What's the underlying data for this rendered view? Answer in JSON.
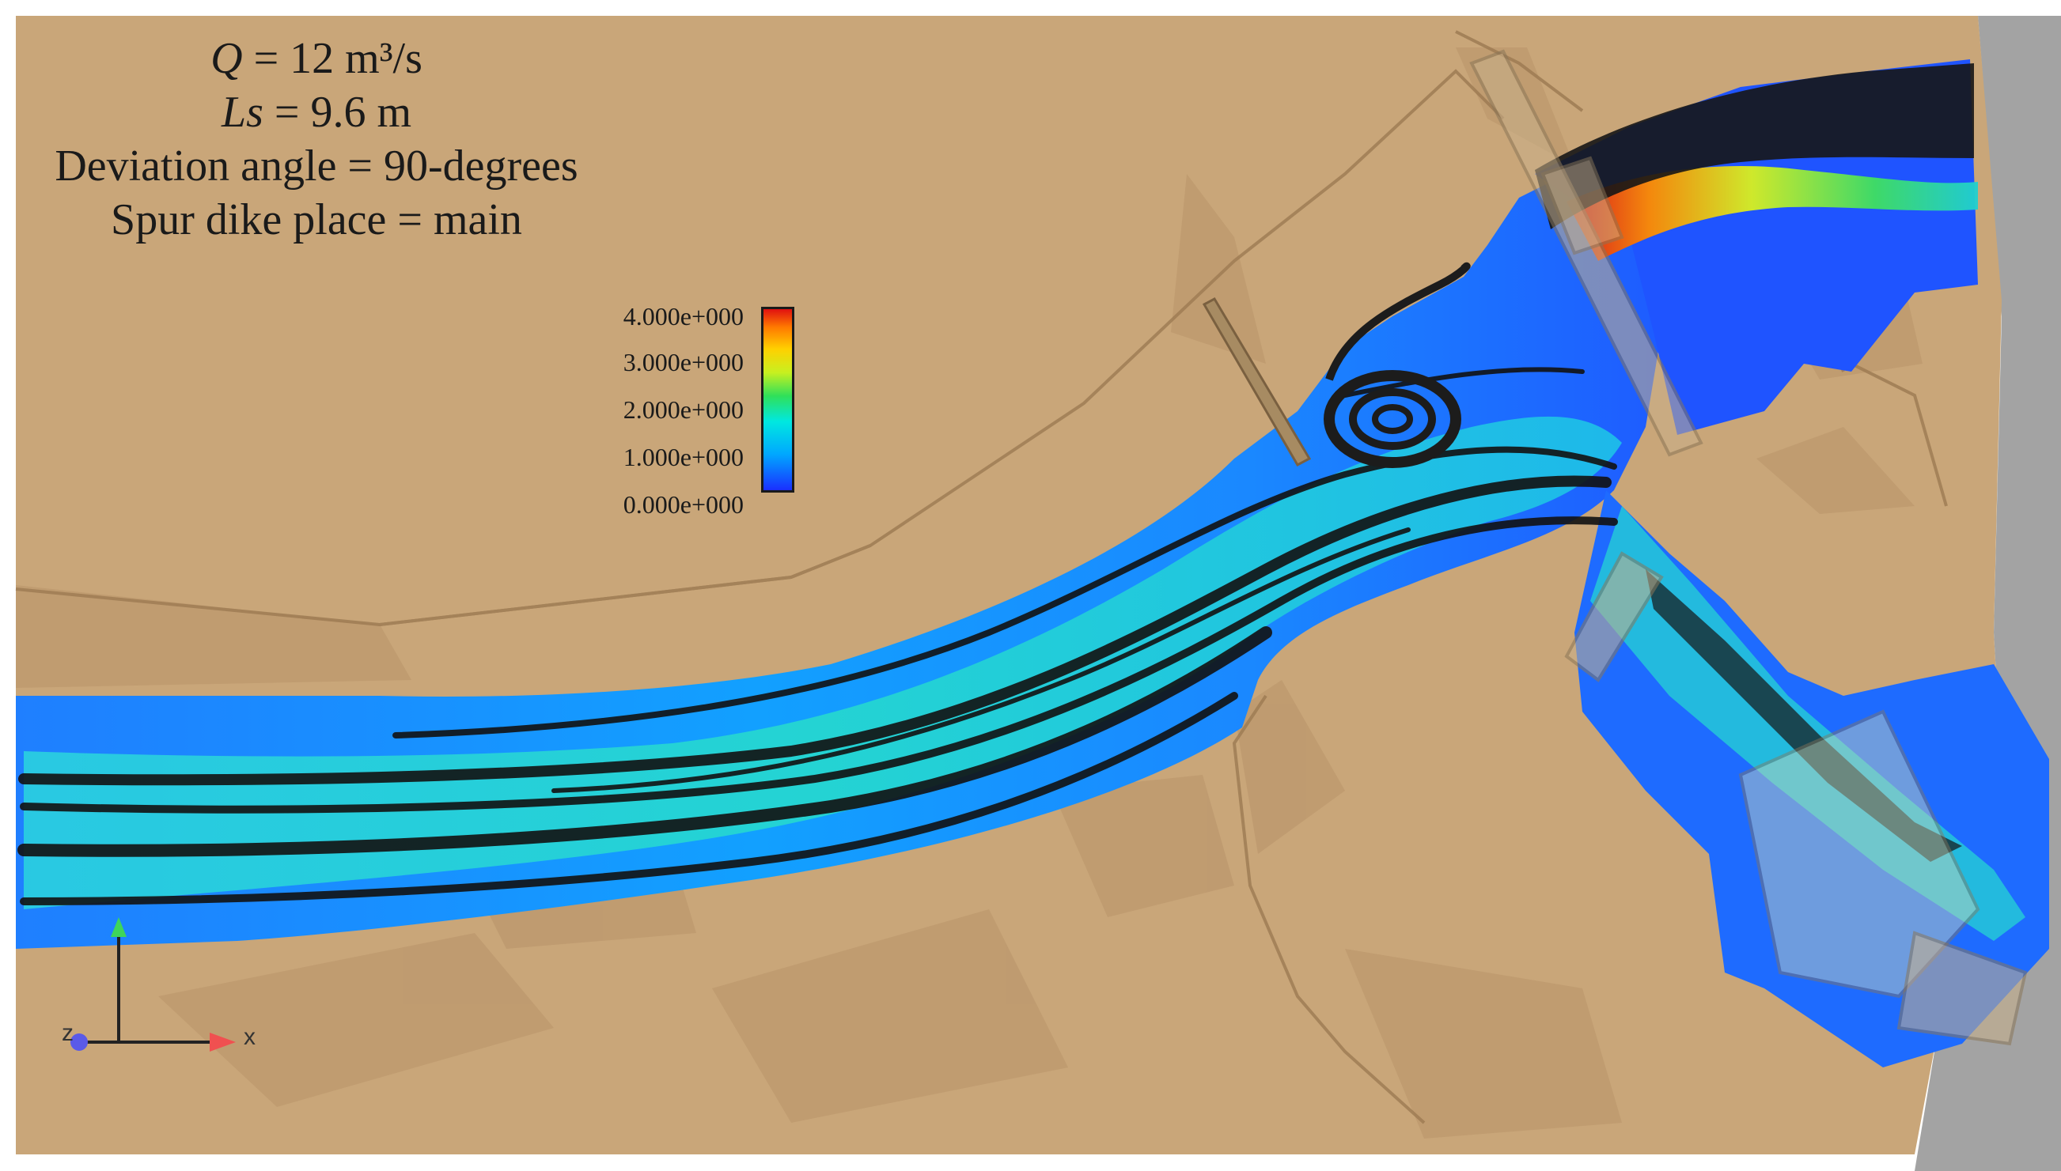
{
  "parameters": {
    "discharge": {
      "symbol": "Q",
      "text": " = 12 m³/s"
    },
    "spacing": {
      "symbol": "Ls",
      "text": " = 9.6 m"
    },
    "deviation_angle": "Deviation angle = 90-degrees",
    "spur_dike_place": "Spur dike place = main"
  },
  "color_legend": {
    "ticks": [
      "4.000e+000",
      "3.000e+000",
      "2.000e+000",
      "1.000e+000",
      "0.000e+000"
    ],
    "colors_low_to_high": [
      "#1a2fff",
      "#00a8ff",
      "#00e8e0",
      "#2fe05a",
      "#c8f020",
      "#ffd000",
      "#ff7a00",
      "#e01010"
    ]
  },
  "axes_triad": {
    "z_label": "z",
    "x_label": "x"
  },
  "colors": {
    "terrain": "#c8a578",
    "terrain_dark": "#b69064",
    "channel_fill": "#1a8cff",
    "streamline_dark": "#141414",
    "streamline_cyan": "#38e6d2",
    "background_gray": "#9a9a9a"
  }
}
